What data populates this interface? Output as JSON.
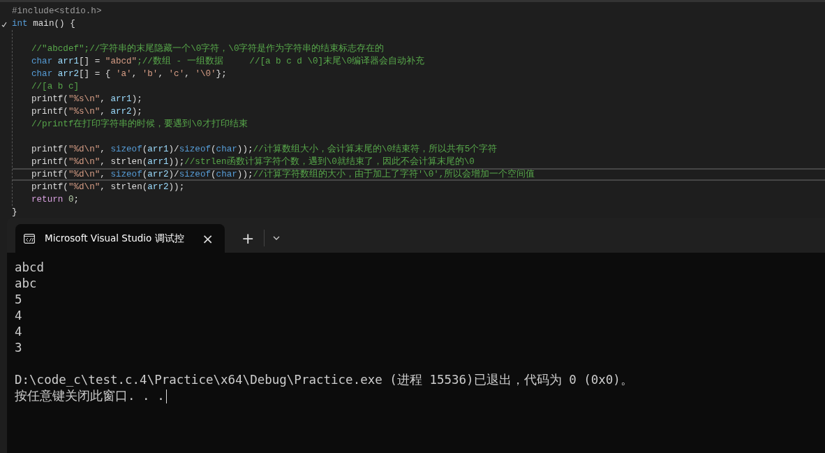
{
  "editor": {
    "lines": [
      {
        "kind": "code",
        "highlighted": false,
        "tokens": [
          {
            "kind": "macro",
            "text": "#include<stdio.h>"
          }
        ]
      },
      {
        "kind": "code",
        "highlighted": false,
        "collapsible": true,
        "tokens": [
          {
            "kind": "kw",
            "text": "int"
          },
          {
            "kind": "plain",
            "text": " main() {"
          }
        ],
        "children": [
          {
            "kind": "blank",
            "highlighted": false
          },
          {
            "kind": "code",
            "highlighted": false,
            "tokens": [
              {
                "kind": "comment",
                "text": "//\"abcdef\";//字符串的末尾隐藏一个\\0字符，\\0字符是作为字符串的结束标志存在的"
              }
            ]
          },
          {
            "kind": "code",
            "highlighted": false,
            "tokens": [
              {
                "kind": "kw",
                "text": "char "
              },
              {
                "kind": "var",
                "text": "arr1"
              },
              {
                "kind": "plain",
                "text": "[] = "
              },
              {
                "kind": "string",
                "text": "\"abcd\""
              },
              {
                "kind": "comment",
                "text": ";//数组 - 一组数据     //[a b c d \\0]末尾\\0编译器会自动补充"
              }
            ]
          },
          {
            "kind": "code",
            "highlighted": false,
            "tokens": [
              {
                "kind": "kw",
                "text": "char "
              },
              {
                "kind": "var",
                "text": "arr2"
              },
              {
                "kind": "plain",
                "text": "[] = { "
              },
              {
                "kind": "string",
                "text": "'a'"
              },
              {
                "kind": "plain",
                "text": ", "
              },
              {
                "kind": "string",
                "text": "'b'"
              },
              {
                "kind": "plain",
                "text": ", "
              },
              {
                "kind": "string",
                "text": "'c'"
              },
              {
                "kind": "plain",
                "text": ", "
              },
              {
                "kind": "string",
                "text": "'\\0'"
              },
              {
                "kind": "plain",
                "text": "};"
              }
            ]
          },
          {
            "kind": "code",
            "highlighted": false,
            "tokens": [
              {
                "kind": "comment",
                "text": "//[a b c]"
              }
            ]
          },
          {
            "kind": "code",
            "highlighted": false,
            "tokens": [
              {
                "kind": "plain",
                "text": "printf("
              },
              {
                "kind": "string",
                "text": "\"%s\\n\""
              },
              {
                "kind": "plain",
                "text": ", "
              },
              {
                "kind": "var",
                "text": "arr1"
              },
              {
                "kind": "plain",
                "text": ");"
              }
            ]
          },
          {
            "kind": "code",
            "highlighted": false,
            "tokens": [
              {
                "kind": "plain",
                "text": "printf("
              },
              {
                "kind": "string",
                "text": "\"%s\\n\""
              },
              {
                "kind": "plain",
                "text": ", "
              },
              {
                "kind": "var",
                "text": "arr2"
              },
              {
                "kind": "plain",
                "text": ");"
              }
            ]
          },
          {
            "kind": "code",
            "highlighted": false,
            "tokens": [
              {
                "kind": "comment",
                "text": "//printf在打印字符串的时候，要遇到\\0才打印结束"
              }
            ]
          },
          {
            "kind": "blank",
            "highlighted": false
          },
          {
            "kind": "code",
            "highlighted": false,
            "tokens": [
              {
                "kind": "plain",
                "text": "printf("
              },
              {
                "kind": "string",
                "text": "\"%d\\n\""
              },
              {
                "kind": "plain",
                "text": ", "
              },
              {
                "kind": "kw",
                "text": "sizeof"
              },
              {
                "kind": "plain",
                "text": "("
              },
              {
                "kind": "var",
                "text": "arr1"
              },
              {
                "kind": "plain",
                "text": ")/"
              },
              {
                "kind": "kw",
                "text": "sizeof"
              },
              {
                "kind": "plain",
                "text": "("
              },
              {
                "kind": "kw",
                "text": "char"
              },
              {
                "kind": "plain",
                "text": "));"
              },
              {
                "kind": "comment",
                "text": "//计算数组大小，会计算末尾的\\0结束符，所以共有5个字符"
              }
            ]
          },
          {
            "kind": "code",
            "highlighted": false,
            "tokens": [
              {
                "kind": "plain",
                "text": "printf("
              },
              {
                "kind": "string",
                "text": "\"%d\\n\""
              },
              {
                "kind": "plain",
                "text": ", strlen("
              },
              {
                "kind": "var",
                "text": "arr1"
              },
              {
                "kind": "plain",
                "text": "));"
              },
              {
                "kind": "comment",
                "text": "//strlen函数计算字符个数，遇到\\0就结束了，因此不会计算末尾的\\0"
              }
            ]
          },
          {
            "kind": "code",
            "highlighted": true,
            "tokens": [
              {
                "kind": "plain",
                "text": "printf("
              },
              {
                "kind": "string",
                "text": "\"%d\\n\""
              },
              {
                "kind": "plain",
                "text": ", "
              },
              {
                "kind": "kw",
                "text": "sizeof"
              },
              {
                "kind": "plain",
                "text": "("
              },
              {
                "kind": "var",
                "text": "arr2"
              },
              {
                "kind": "plain",
                "text": ")/"
              },
              {
                "kind": "kw",
                "text": "sizeof"
              },
              {
                "kind": "plain",
                "text": "("
              },
              {
                "kind": "kw",
                "text": "char"
              },
              {
                "kind": "plain",
                "text": "));"
              },
              {
                "kind": "comment",
                "text": "//计算字符数组的大小，由于加上了字符'\\0',所以会增加一个空间值"
              }
            ]
          },
          {
            "kind": "code",
            "highlighted": false,
            "tokens": [
              {
                "kind": "plain",
                "text": "printf("
              },
              {
                "kind": "string",
                "text": "\"%d\\n\""
              },
              {
                "kind": "plain",
                "text": ", strlen("
              },
              {
                "kind": "var",
                "text": "arr2"
              },
              {
                "kind": "plain",
                "text": "));"
              }
            ]
          },
          {
            "kind": "code",
            "highlighted": false,
            "tokens": [
              {
                "kind": "ret",
                "text": "return "
              },
              {
                "kind": "num",
                "text": "0"
              },
              {
                "kind": "plain",
                "text": ";"
              }
            ]
          }
        ]
      },
      {
        "kind": "code",
        "highlighted": false,
        "tokens": [
          {
            "kind": "plain",
            "text": "}"
          }
        ]
      }
    ]
  },
  "terminal": {
    "tab": {
      "title": "Microsoft Visual Studio 调试控",
      "close": "×"
    },
    "new_tab": "+",
    "output": [
      "abcd",
      "abc",
      "5",
      "4",
      "4",
      "3"
    ],
    "messages": [
      "D:\\code_c\\test.c.4\\Practice\\x64\\Debug\\Practice.exe (进程 15536)已退出，代码为 0 (0x0)。",
      "按任意键关闭此窗口. . ."
    ]
  }
}
